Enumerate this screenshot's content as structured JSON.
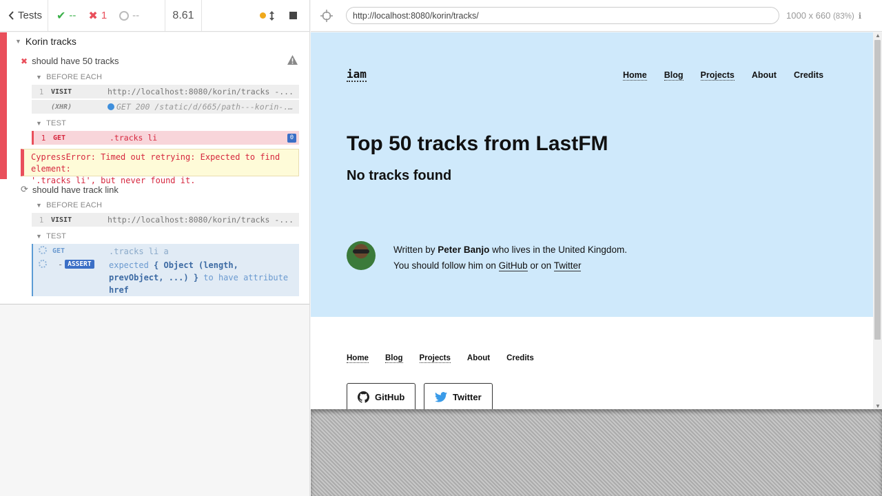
{
  "reporter": {
    "tests_label": "Tests",
    "passed": "--",
    "failed": "1",
    "pending": "--",
    "duration": "8.61",
    "suite_title": "Korin tracks",
    "tests": [
      {
        "title": "should have 50 tracks",
        "before_each_label": "BEFORE EACH",
        "visit": {
          "num": "1",
          "name": "VISIT",
          "msg": "http://localhost:8080/korin/tracks -..."
        },
        "xhr": {
          "name": "(XHR)",
          "msg": "GET 200 /static/d/665/path---korin-..."
        },
        "test_label": "TEST",
        "get": {
          "num": "1",
          "name": "GET",
          "msg": ".tracks li",
          "count": "0"
        },
        "error_line1": "CypressError: Timed out retrying: Expected to find element:",
        "error_line2": "'.tracks li', but never found it."
      },
      {
        "title": "should have track link",
        "before_each_label": "BEFORE EACH",
        "visit": {
          "num": "1",
          "name": "VISIT",
          "msg": "http://localhost:8080/korin/tracks -..."
        },
        "test_label": "TEST",
        "get": {
          "name": "GET",
          "msg": ".tracks li a"
        },
        "assert": {
          "dash": "-",
          "name": "ASSERT",
          "expected": "expected",
          "object1": "{ Object (length,",
          "object2": "prevObject, ...) }",
          "to_have": "to have attribute",
          "attr": "href"
        }
      }
    ]
  },
  "browser": {
    "url": "http://localhost:8080/korin/tracks/",
    "viewport": "1000 x 660",
    "zoom": "(83%)"
  },
  "site": {
    "logo": "iam",
    "nav": [
      "Home",
      "Blog",
      "Projects",
      "About",
      "Credits"
    ],
    "heading": "Top 50 tracks from LastFM",
    "subheading": "No tracks found",
    "bio_written_by": "Written by",
    "bio_name": "Peter Banjo",
    "bio_lives": "who lives in the United Kingdom.",
    "bio_follow": "You should follow him on",
    "bio_github": "GitHub",
    "bio_or": "or on",
    "bio_twitter": "Twitter",
    "footer_nav": [
      "Home",
      "Blog",
      "Projects",
      "About",
      "Credits"
    ],
    "github_button": "GitHub",
    "twitter_button": "Twitter"
  },
  "colors": {
    "fail": "#e94f5b",
    "pass": "#3bb04a",
    "hero_bg": "#cfe9fb",
    "accent_blue": "#3b6fc6"
  }
}
